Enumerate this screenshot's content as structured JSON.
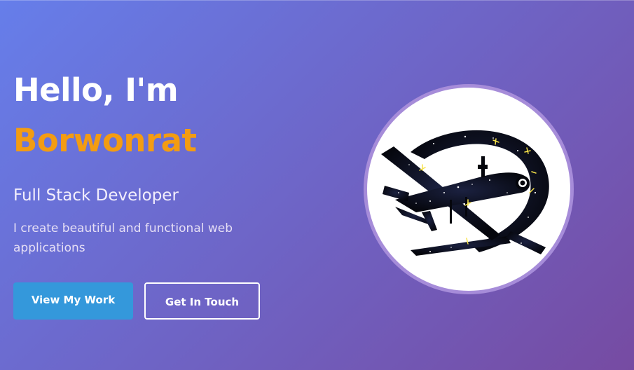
{
  "hero": {
    "greeting": "Hello, I'm",
    "name": "Borwonrat",
    "role": "Full Stack Developer",
    "tagline": "I create beautiful and functional web applications",
    "primary_button": "View My Work",
    "secondary_button": "Get In Touch"
  },
  "avatar": {
    "icon": "drone-space-logo"
  },
  "colors": {
    "gradient_start": "#667eea",
    "gradient_end": "#764ba2",
    "accent": "#f39c12",
    "primary_button": "#3498db"
  }
}
